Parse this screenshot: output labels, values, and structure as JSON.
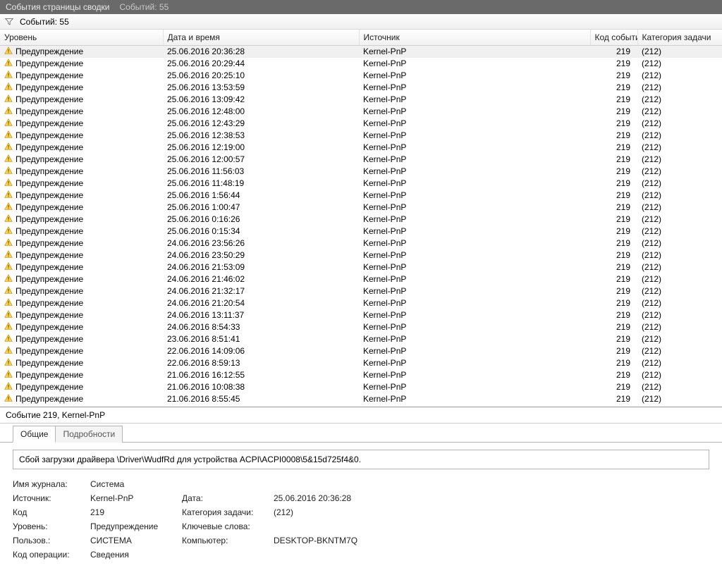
{
  "titlebar": {
    "primary": "События страницы сводки",
    "secondary": "Событий: 55"
  },
  "filterbar": {
    "count_label": "Событий: 55"
  },
  "columns": {
    "level": "Уровень",
    "datetime": "Дата и время",
    "source": "Источник",
    "code": "Код события",
    "category": "Категория задачи"
  },
  "level_label": "Предупреждение",
  "events": [
    {
      "dt": "25.06.2016 20:36:28",
      "src": "Kernel-PnP",
      "code": "219",
      "cat": "(212)",
      "sel": true
    },
    {
      "dt": "25.06.2016 20:29:44",
      "src": "Kernel-PnP",
      "code": "219",
      "cat": "(212)"
    },
    {
      "dt": "25.06.2016 20:25:10",
      "src": "Kernel-PnP",
      "code": "219",
      "cat": "(212)"
    },
    {
      "dt": "25.06.2016 13:53:59",
      "src": "Kernel-PnP",
      "code": "219",
      "cat": "(212)"
    },
    {
      "dt": "25.06.2016 13:09:42",
      "src": "Kernel-PnP",
      "code": "219",
      "cat": "(212)"
    },
    {
      "dt": "25.06.2016 12:48:00",
      "src": "Kernel-PnP",
      "code": "219",
      "cat": "(212)"
    },
    {
      "dt": "25.06.2016 12:43:29",
      "src": "Kernel-PnP",
      "code": "219",
      "cat": "(212)"
    },
    {
      "dt": "25.06.2016 12:38:53",
      "src": "Kernel-PnP",
      "code": "219",
      "cat": "(212)"
    },
    {
      "dt": "25.06.2016 12:19:00",
      "src": "Kernel-PnP",
      "code": "219",
      "cat": "(212)"
    },
    {
      "dt": "25.06.2016 12:00:57",
      "src": "Kernel-PnP",
      "code": "219",
      "cat": "(212)"
    },
    {
      "dt": "25.06.2016 11:56:03",
      "src": "Kernel-PnP",
      "code": "219",
      "cat": "(212)"
    },
    {
      "dt": "25.06.2016 11:48:19",
      "src": "Kernel-PnP",
      "code": "219",
      "cat": "(212)"
    },
    {
      "dt": "25.06.2016 1:56:44",
      "src": "Kernel-PnP",
      "code": "219",
      "cat": "(212)"
    },
    {
      "dt": "25.06.2016 1:00:47",
      "src": "Kernel-PnP",
      "code": "219",
      "cat": "(212)"
    },
    {
      "dt": "25.06.2016 0:16:26",
      "src": "Kernel-PnP",
      "code": "219",
      "cat": "(212)"
    },
    {
      "dt": "25.06.2016 0:15:34",
      "src": "Kernel-PnP",
      "code": "219",
      "cat": "(212)"
    },
    {
      "dt": "24.06.2016 23:56:26",
      "src": "Kernel-PnP",
      "code": "219",
      "cat": "(212)"
    },
    {
      "dt": "24.06.2016 23:50:29",
      "src": "Kernel-PnP",
      "code": "219",
      "cat": "(212)"
    },
    {
      "dt": "24.06.2016 21:53:09",
      "src": "Kernel-PnP",
      "code": "219",
      "cat": "(212)"
    },
    {
      "dt": "24.06.2016 21:46:02",
      "src": "Kernel-PnP",
      "code": "219",
      "cat": "(212)"
    },
    {
      "dt": "24.06.2016 21:32:17",
      "src": "Kernel-PnP",
      "code": "219",
      "cat": "(212)"
    },
    {
      "dt": "24.06.2016 21:20:54",
      "src": "Kernel-PnP",
      "code": "219",
      "cat": "(212)"
    },
    {
      "dt": "24.06.2016 13:11:37",
      "src": "Kernel-PnP",
      "code": "219",
      "cat": "(212)"
    },
    {
      "dt": "24.06.2016 8:54:33",
      "src": "Kernel-PnP",
      "code": "219",
      "cat": "(212)"
    },
    {
      "dt": "23.06.2016 8:51:41",
      "src": "Kernel-PnP",
      "code": "219",
      "cat": "(212)"
    },
    {
      "dt": "22.06.2016 14:09:06",
      "src": "Kernel-PnP",
      "code": "219",
      "cat": "(212)"
    },
    {
      "dt": "22.06.2016 8:59:13",
      "src": "Kernel-PnP",
      "code": "219",
      "cat": "(212)"
    },
    {
      "dt": "21.06.2016 16:12:55",
      "src": "Kernel-PnP",
      "code": "219",
      "cat": "(212)"
    },
    {
      "dt": "21.06.2016 10:08:38",
      "src": "Kernel-PnP",
      "code": "219",
      "cat": "(212)"
    },
    {
      "dt": "21.06.2016 8:55:45",
      "src": "Kernel-PnP",
      "code": "219",
      "cat": "(212)"
    }
  ],
  "detail": {
    "header": "Событие 219, Kernel-PnP",
    "tabs": {
      "general": "Общие",
      "details": "Подробности"
    },
    "message": "Сбой загрузки драйвера \\Driver\\WudfRd для устройства ACPI\\ACPI0008\\5&15d725f4&0.",
    "fields": {
      "log_name_lbl": "Имя журнала:",
      "log_name_val": "Система",
      "source_lbl": "Источник:",
      "source_val": "Kernel-PnP",
      "date_lbl": "Дата:",
      "date_val": "25.06.2016 20:36:28",
      "code_lbl": "Код",
      "code_val": "219",
      "category_lbl": "Категория задачи:",
      "category_val": "(212)",
      "level_lbl": "Уровень:",
      "level_val": "Предупреждение",
      "keywords_lbl": "Ключевые слова:",
      "keywords_val": "",
      "user_lbl": "Пользов.:",
      "user_val": "СИСТЕМА",
      "computer_lbl": "Компьютер:",
      "computer_val": "DESKTOP-BKNTM7Q",
      "opcode_lbl": "Код операции:",
      "opcode_val": "Сведения"
    }
  }
}
